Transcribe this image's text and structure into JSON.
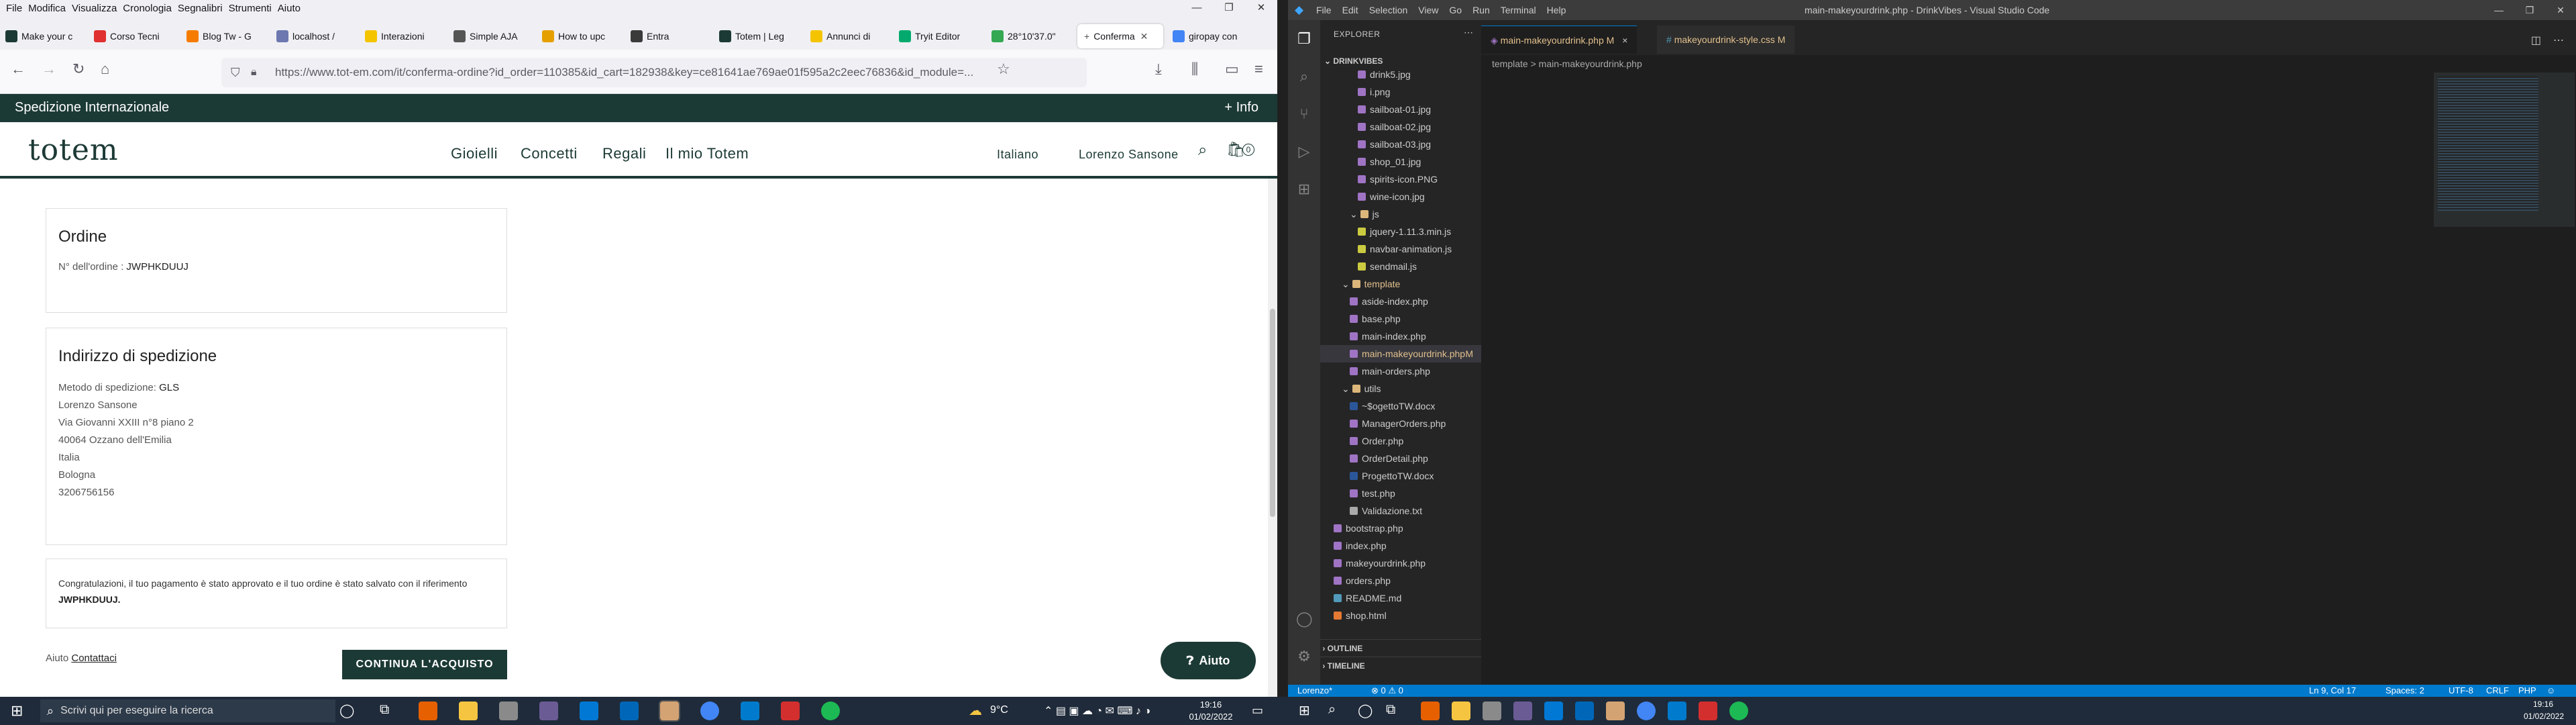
{
  "firefox": {
    "menu": [
      "File",
      "Modifica",
      "Visualizza",
      "Cronologia",
      "Segnalibri",
      "Strumenti",
      "Aiuto"
    ],
    "tabs": [
      "Make your c",
      "Corso Tecni",
      "Blog Tw - G",
      "localhost / ",
      "Interazioni",
      "Simple AJA",
      "How to upc",
      "Entra",
      "Totem | Leg",
      "Annunci di ",
      "Tryit Editor",
      "28°10'37.0\"",
      "Conferma",
      "giropay con"
    ],
    "url": "https://www.tot-em.com/it/conferma-ordine?id_order=110385&id_cart=182938&key=ce81641ae769ae01f595a2c2eec76836&id_module=..."
  },
  "site": {
    "top_left": "Spedizione Internazionale",
    "top_right": "+ Info",
    "logo": "totem",
    "nav": [
      "Gioielli",
      "Concetti",
      "Regali",
      "Il mio Totem"
    ],
    "language": "Italiano",
    "user": "Lorenzo Sansone",
    "cart_count": "0",
    "order": {
      "title": "Ordine",
      "number_label": "N° dell'ordine :",
      "number": "JWPHKDUUJ"
    },
    "shipping": {
      "title": "Indirizzo di spedizione",
      "method_label": "Metodo di spedizione:",
      "method": "GLS",
      "lines": [
        "Lorenzo Sansone",
        "Via Giovanni XXIII n°8 piano 2",
        "40064 Ozzano dell'Emilia",
        "Italia",
        "Bologna",
        "3206756156"
      ]
    },
    "confirm_text": "Congratulazioni, il tuo pagamento è stato approvato e il tuo ordine è stato salvato con il riferimento",
    "confirm_ref": "JWPHKDUUJ.",
    "help_label": "Aiuto",
    "help_link": "Contattaci",
    "continue_button": "CONTINUA L'ACQUISTO",
    "aiuto_button": "Aiuto"
  },
  "vscode": {
    "menu": [
      "File",
      "Edit",
      "Selection",
      "View",
      "Go",
      "Run",
      "Terminal",
      "Help"
    ],
    "title": "main-makeyourdrink.php - DrinkVibes - Visual Studio Code",
    "explorer_title": "EXPLORER",
    "project": "DRINKVIBES",
    "tree": [
      {
        "name": "drink5.jpg",
        "indent": 4,
        "color": "#a074c4"
      },
      {
        "name": "i.png",
        "indent": 4,
        "color": "#a074c4"
      },
      {
        "name": "sailboat-01.jpg",
        "indent": 4,
        "color": "#a074c4"
      },
      {
        "name": "sailboat-02.jpg",
        "indent": 4,
        "color": "#a074c4"
      },
      {
        "name": "sailboat-03.jpg",
        "indent": 4,
        "color": "#a074c4"
      },
      {
        "name": "shop_01.jpg",
        "indent": 4,
        "color": "#a074c4"
      },
      {
        "name": "spirits-icon.PNG",
        "indent": 4,
        "color": "#a074c4"
      },
      {
        "name": "wine-icon.jpg",
        "indent": 4,
        "color": "#a074c4"
      },
      {
        "name": "js",
        "indent": 3,
        "color": "#dcb67a",
        "folder": true
      },
      {
        "name": "jquery-1.11.3.min.js",
        "indent": 4,
        "color": "#cbcb41"
      },
      {
        "name": "navbar-animation.js",
        "indent": 4,
        "color": "#cbcb41"
      },
      {
        "name": "sendmail.js",
        "indent": 4,
        "color": "#cbcb41"
      },
      {
        "name": "template",
        "indent": 2,
        "color": "#dcb67a",
        "folder": true,
        "text": "#e2c08d"
      },
      {
        "name": "aside-index.php",
        "indent": 3,
        "color": "#a074c4"
      },
      {
        "name": "base.php",
        "indent": 3,
        "color": "#a074c4"
      },
      {
        "name": "main-index.php",
        "indent": 3,
        "color": "#a074c4"
      },
      {
        "name": "main-makeyourdrink.php",
        "indent": 3,
        "color": "#a074c4",
        "text": "#e2c08d",
        "selected": true,
        "badge": "M"
      },
      {
        "name": "main-orders.php",
        "indent": 3,
        "color": "#a074c4"
      },
      {
        "name": "utils",
        "indent": 2,
        "color": "#dcb67a",
        "folder": true
      },
      {
        "name": "~$ogettoTW.docx",
        "indent": 3,
        "color": "#2b579a"
      },
      {
        "name": "ManagerOrders.php",
        "indent": 3,
        "color": "#a074c4"
      },
      {
        "name": "Order.php",
        "indent": 3,
        "color": "#a074c4"
      },
      {
        "name": "OrderDetail.php",
        "indent": 3,
        "color": "#a074c4"
      },
      {
        "name": "ProgettoTW.docx",
        "indent": 3,
        "color": "#2b579a"
      },
      {
        "name": "test.php",
        "indent": 3,
        "color": "#a074c4"
      },
      {
        "name": "Validazione.txt",
        "indent": 3,
        "color": "#aaaaaa"
      },
      {
        "name": "bootstrap.php",
        "indent": 1,
        "color": "#a074c4"
      },
      {
        "name": "index.php",
        "indent": 1,
        "color": "#a074c4"
      },
      {
        "name": "makeyourdrink.php",
        "indent": 1,
        "color": "#a074c4"
      },
      {
        "name": "orders.php",
        "indent": 1,
        "color": "#a074c4"
      },
      {
        "name": "README.md",
        "indent": 1,
        "color": "#519aba"
      },
      {
        "name": "shop.html",
        "indent": 1,
        "color": "#e37933"
      }
    ],
    "outline": "OUTLINE",
    "timeline": "TIMELINE",
    "tabs": [
      {
        "label": "main-makeyourdrink.php",
        "badge": "M",
        "close": "×"
      },
      {
        "label": "makeyourdrink-style.css",
        "badge": "M"
      }
    ],
    "breadcrumb": [
      "template",
      ">",
      "main-makeyourdrink.php"
    ],
    "status": {
      "left": [
        "Lorenzo*",
        "⊗ 0 ⚠ 0"
      ],
      "right": [
        "Ln 9, Col 17",
        "Spaces: 2",
        "UTF-8",
        "CRLF",
        "PHP"
      ]
    }
  },
  "taskbar": {
    "search_placeholder": "Scrivi qui per eseguire la ricerca",
    "weather": "9°C",
    "time": "19:16",
    "date": "01/02/2022",
    "time2": "19:16",
    "date2": "01/02/2022"
  }
}
